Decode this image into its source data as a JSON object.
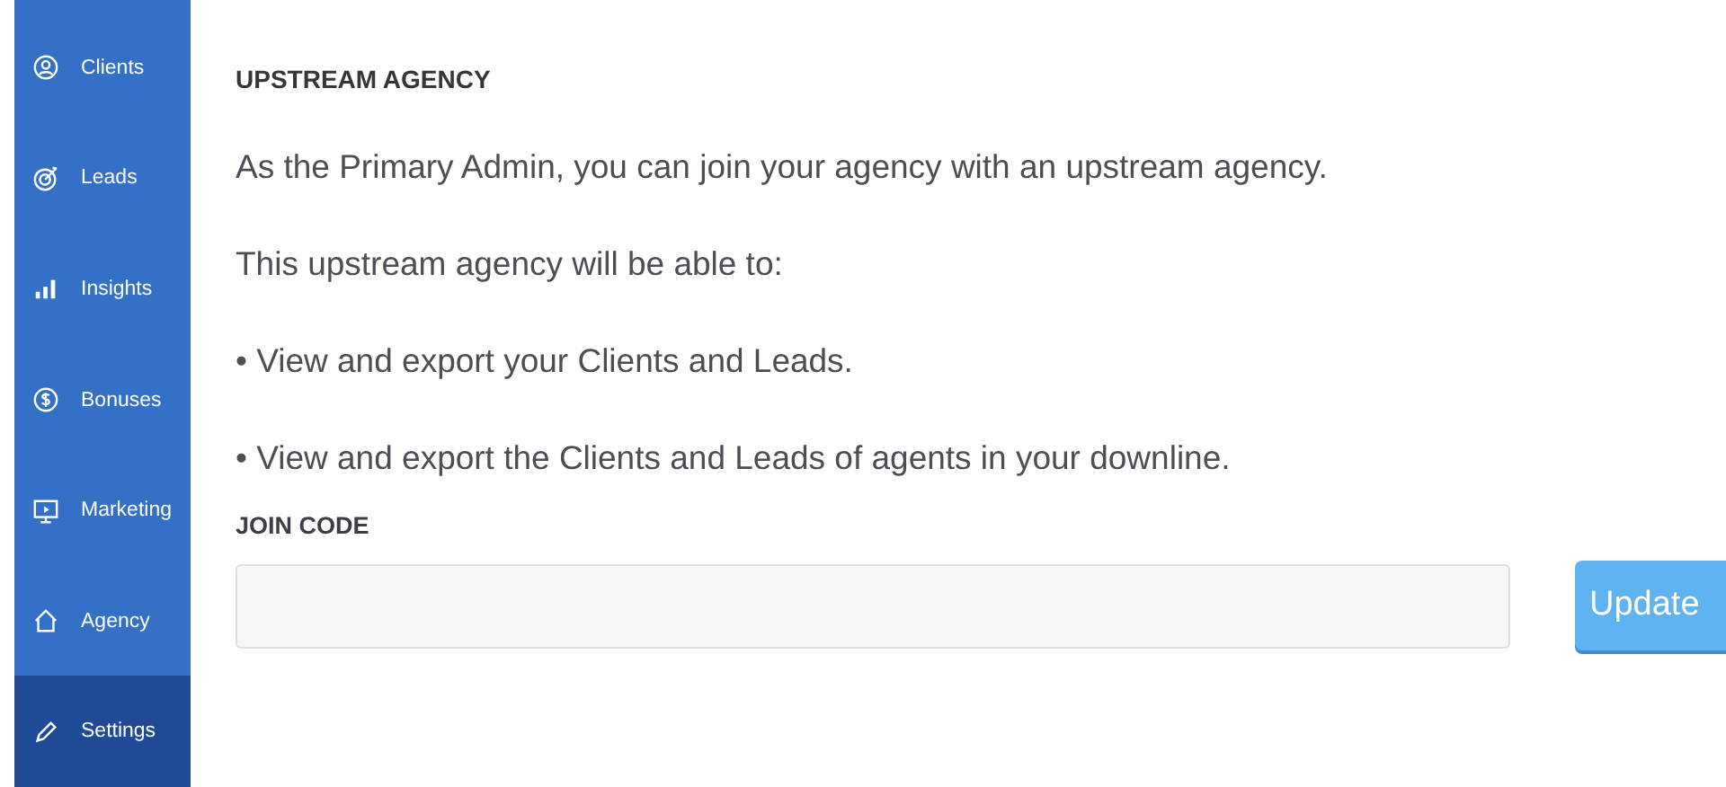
{
  "sidebar": {
    "items": [
      {
        "label": "Clients",
        "selected": false
      },
      {
        "label": "Leads",
        "selected": false
      },
      {
        "label": "Insights",
        "selected": false
      },
      {
        "label": "Bonuses",
        "selected": false
      },
      {
        "label": "Marketing",
        "selected": false
      },
      {
        "label": "Agency",
        "selected": false
      },
      {
        "label": "Settings",
        "selected": true
      }
    ]
  },
  "section": {
    "title": "UPSTREAM AGENCY",
    "paragraphs": [
      "As the Primary Admin, you can join your agency with an upstream agency.",
      "This upstream agency will be able to:",
      "• View and export your Clients and Leads.",
      "• View and export the Clients and Leads of agents in your downline."
    ],
    "field_label": "JOIN CODE",
    "button": "Update"
  }
}
